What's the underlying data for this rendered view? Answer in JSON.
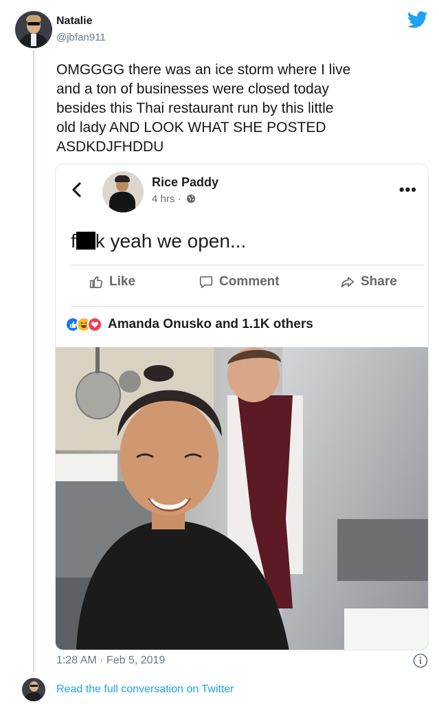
{
  "tweet": {
    "author_name": "Natalie",
    "author_handle": "@jbfan911",
    "text": "OMGGGG there was an ice storm where I live\nand a ton of businesses were closed today\nbesides this Thai restaurant run by this little\nold lady AND LOOK WHAT SHE POSTED\nASDKDJFHDDU",
    "timestamp": "1:28 AM · Feb 5, 2019",
    "read_more": "Read the full conversation on Twitter",
    "brand_color": "#1da1f2"
  },
  "post": {
    "page_name": "Rice Paddy",
    "time": "4 hrs ·",
    "text_prefix": "f",
    "text_suffix": "k yeah we open...",
    "actions": {
      "like": "Like",
      "comment": "Comment",
      "share": "Share"
    },
    "reactions_text": "Amanda Onusko and 1.1K others",
    "reaction_icons": [
      "like-icon",
      "haha-icon",
      "love-icon"
    ],
    "more_icon": "•••"
  }
}
